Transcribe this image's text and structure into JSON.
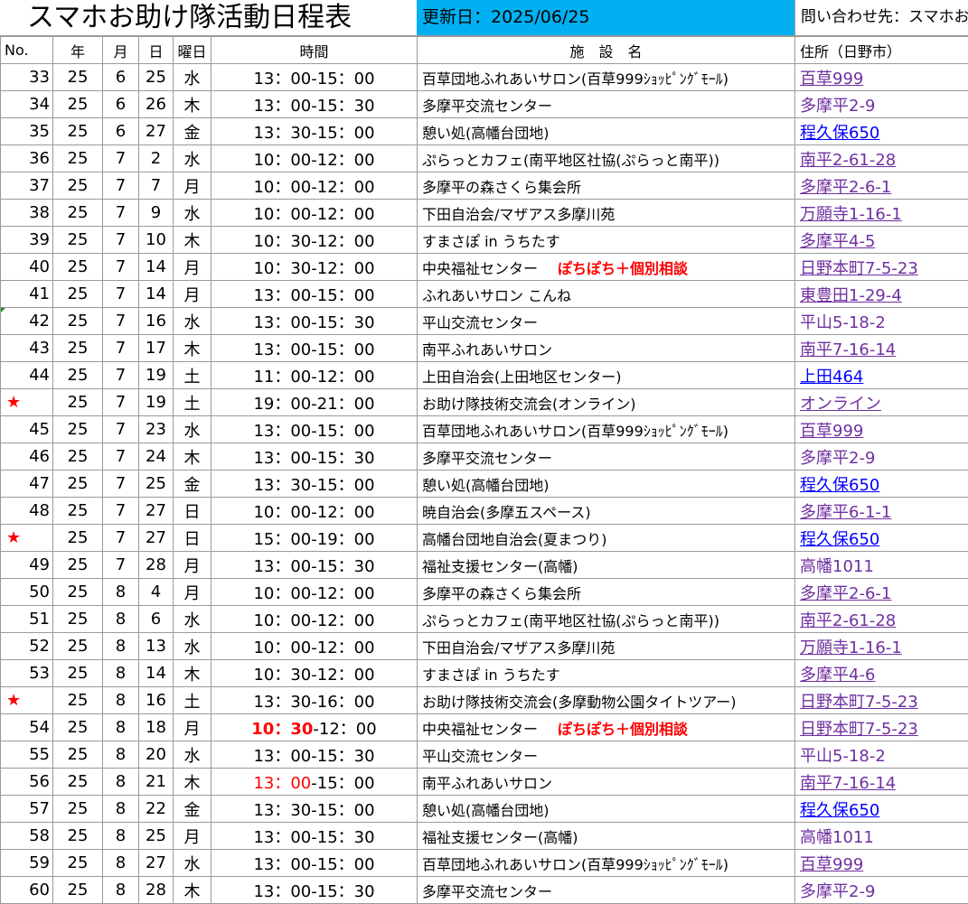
{
  "header": {
    "title": "スマホお助け隊活動日程表",
    "updated": "更新日：2025/06/25",
    "contact": "問い合わせ先：スマホお"
  },
  "columns": [
    "No.",
    "年",
    "月",
    "日",
    "曜日",
    "時間",
    "施　設　名",
    "住所（日野市）"
  ],
  "rows": [
    {
      "no": "33",
      "y": "25",
      "m": "6",
      "d": "25",
      "w": "水",
      "time": "13：00-15：00",
      "fac": "百草団地ふれあいサロン(百草999ｼｮｯﾋﾟﾝｸﾞﾓｰﾙ)",
      "addr": "百草999",
      "addr_style": "link-v"
    },
    {
      "no": "34",
      "y": "25",
      "m": "6",
      "d": "26",
      "w": "木",
      "time": "13：00-15：30",
      "fac": "多摩平交流センター",
      "addr": "多摩平2-9",
      "addr_style": "plain-v"
    },
    {
      "no": "35",
      "y": "25",
      "m": "6",
      "d": "27",
      "w": "金",
      "time": "13：30-15：00",
      "fac": "憩い処(高幡台団地)",
      "addr": "程久保650",
      "addr_style": "link-b"
    },
    {
      "no": "36",
      "y": "25",
      "m": "7",
      "d": "2",
      "w": "水",
      "time": "10：00-12：00",
      "fac": "ぷらっとカフェ(南平地区社協(ぷらっと南平))",
      "addr": "南平2-61-28",
      "addr_style": "link-v"
    },
    {
      "no": "37",
      "y": "25",
      "m": "7",
      "d": "7",
      "w": "月",
      "time": "10：00-12：00",
      "fac": "多摩平の森さくら集会所",
      "addr": "多摩平2-6-1",
      "addr_style": "link-v"
    },
    {
      "no": "38",
      "y": "25",
      "m": "7",
      "d": "9",
      "w": "水",
      "time": "10：00-12：00",
      "fac": "下田自治会/マザアス多摩川苑",
      "addr": "万願寺1-16-1",
      "addr_style": "link-v"
    },
    {
      "no": "39",
      "y": "25",
      "m": "7",
      "d": "10",
      "w": "木",
      "time": "10：30-12：00",
      "fac": "すまさぽ in うちたす",
      "addr": "多摩平4-5",
      "addr_style": "link-v"
    },
    {
      "no": "40",
      "y": "25",
      "m": "7",
      "d": "14",
      "w": "月",
      "time": "10：30-12：00",
      "fac": "中央福祉センター",
      "note": "ぽちぽち＋個別相談",
      "addr": "日野本町7-5-23",
      "addr_style": "link-v"
    },
    {
      "no": "41",
      "y": "25",
      "m": "7",
      "d": "14",
      "w": "月",
      "time": "13：00-15：00",
      "fac": "ふれあいサロン こんね",
      "addr": "東豊田1-29-4",
      "addr_style": "link-v"
    },
    {
      "no": "42",
      "y": "25",
      "m": "7",
      "d": "16",
      "w": "水",
      "time": "13：00-15：30",
      "fac": "平山交流センター",
      "addr": "平山5-18-2",
      "addr_style": "plain-v"
    },
    {
      "no": "43",
      "y": "25",
      "m": "7",
      "d": "17",
      "w": "木",
      "time": "13：00-15：00",
      "fac": "南平ふれあいサロン",
      "addr": "南平7-16-14",
      "addr_style": "link-v"
    },
    {
      "no": "44",
      "y": "25",
      "m": "7",
      "d": "19",
      "w": "土",
      "time": "11：00-12：00",
      "fac": "上田自治会(上田地区センター)",
      "addr": "上田464",
      "addr_style": "link-b"
    },
    {
      "no": "★",
      "star": true,
      "y": "25",
      "m": "7",
      "d": "19",
      "w": "土",
      "time": "19：00-21：00",
      "fac": "お助け隊技術交流会(オンライン)",
      "addr": "オンライン",
      "addr_style": "link-v"
    },
    {
      "no": "45",
      "y": "25",
      "m": "7",
      "d": "23",
      "w": "水",
      "time": "13：00-15：00",
      "fac": "百草団地ふれあいサロン(百草999ｼｮｯﾋﾟﾝｸﾞﾓｰﾙ)",
      "addr": "百草999",
      "addr_style": "link-v"
    },
    {
      "no": "46",
      "y": "25",
      "m": "7",
      "d": "24",
      "w": "木",
      "time": "13：00-15：30",
      "fac": "多摩平交流センター",
      "addr": "多摩平2-9",
      "addr_style": "plain-v"
    },
    {
      "no": "47",
      "y": "25",
      "m": "7",
      "d": "25",
      "w": "金",
      "time": "13：30-15：00",
      "fac": "憩い処(高幡台団地)",
      "addr": "程久保650",
      "addr_style": "link-b"
    },
    {
      "no": "48",
      "y": "25",
      "m": "7",
      "d": "27",
      "w": "日",
      "time": "10：00-12：00",
      "fac": "暁自治会(多摩五スペース)",
      "addr": "多摩平6-1-1",
      "addr_style": "link-v"
    },
    {
      "no": "★",
      "star": true,
      "y": "25",
      "m": "7",
      "d": "27",
      "w": "日",
      "time": "15：00-19：00",
      "fac": "高幡台団地自治会(夏まつり)",
      "addr": "程久保650",
      "addr_style": "link-b"
    },
    {
      "no": "49",
      "y": "25",
      "m": "7",
      "d": "28",
      "w": "月",
      "time": "13：00-15：30",
      "fac": "福祉支援センター(高幡)",
      "addr": "高幡1011",
      "addr_style": "plain-v"
    },
    {
      "no": "50",
      "y": "25",
      "m": "8",
      "d": "4",
      "w": "月",
      "time": "10：00-12：00",
      "fac": "多摩平の森さくら集会所",
      "addr": "多摩平2-6-1",
      "addr_style": "link-v"
    },
    {
      "no": "51",
      "y": "25",
      "m": "8",
      "d": "6",
      "w": "水",
      "time": "10：00-12：00",
      "fac": "ぷらっとカフェ(南平地区社協(ぷらっと南平))",
      "addr": "南平2-61-28",
      "addr_style": "link-v"
    },
    {
      "no": "52",
      "y": "25",
      "m": "8",
      "d": "13",
      "w": "水",
      "time": "10：00-12：00",
      "fac": "下田自治会/マザアス多摩川苑",
      "addr": "万願寺1-16-1",
      "addr_style": "link-v"
    },
    {
      "no": "53",
      "y": "25",
      "m": "8",
      "d": "14",
      "w": "木",
      "time": "10：30-12：00",
      "fac": "すまさぽ in うちたす",
      "addr": "多摩平4-6",
      "addr_style": "link-v"
    },
    {
      "no": "★",
      "star": true,
      "y": "25",
      "m": "8",
      "d": "16",
      "w": "土",
      "time": "13：30-16：00",
      "fac": "お助け隊技術交流会(多摩動物公園タイトツアー)",
      "addr": "日野本町7-5-23",
      "addr_style": "link-v"
    },
    {
      "no": "54",
      "y": "25",
      "m": "8",
      "d": "18",
      "w": "月",
      "time": "",
      "time_red": "10：30",
      "time_rest": "-12：00",
      "time_bold": true,
      "fac": "中央福祉センター",
      "note": "ぽちぽち＋個別相談",
      "addr": "日野本町7-5-23",
      "addr_style": "link-v"
    },
    {
      "no": "55",
      "y": "25",
      "m": "8",
      "d": "20",
      "w": "水",
      "time": "13：00-15：30",
      "fac": "平山交流センター",
      "addr": "平山5-18-2",
      "addr_style": "plain-v"
    },
    {
      "no": "56",
      "y": "25",
      "m": "8",
      "d": "21",
      "w": "木",
      "time": "",
      "time_red": "13：00",
      "time_rest": "-15：00",
      "fac": "南平ふれあいサロン",
      "addr": "南平7-16-14",
      "addr_style": "link-v"
    },
    {
      "no": "57",
      "y": "25",
      "m": "8",
      "d": "22",
      "w": "金",
      "time": "13：30-15：00",
      "fac": "憩い処(高幡台団地)",
      "addr": "程久保650",
      "addr_style": "link-b"
    },
    {
      "no": "58",
      "y": "25",
      "m": "8",
      "d": "25",
      "w": "月",
      "time": "13：00-15：30",
      "fac": "福祉支援センター(高幡)",
      "addr": "高幡1011",
      "addr_style": "plain-v"
    },
    {
      "no": "59",
      "y": "25",
      "m": "8",
      "d": "27",
      "w": "水",
      "time": "13：00-15：00",
      "fac": "百草団地ふれあいサロン(百草999ｼｮｯﾋﾟﾝｸﾞﾓｰﾙ)",
      "addr": "百草999",
      "addr_style": "link-v"
    },
    {
      "no": "60",
      "y": "25",
      "m": "8",
      "d": "28",
      "w": "木",
      "time": "13：00-15：30",
      "fac": "多摩平交流センター",
      "addr": "多摩平2-9",
      "addr_style": "plain-v"
    }
  ]
}
